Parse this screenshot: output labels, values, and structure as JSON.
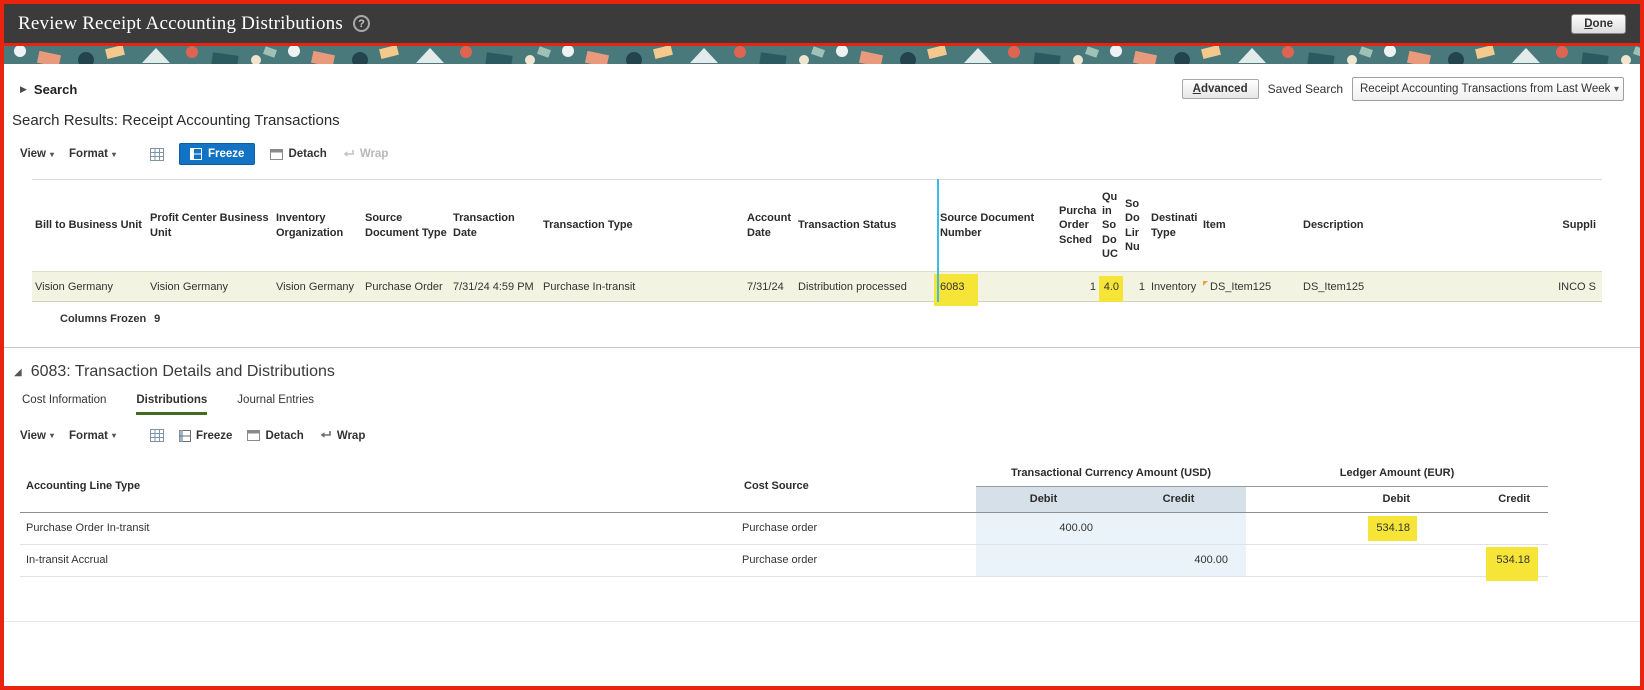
{
  "colors": {
    "annotation_red": "#e8240f",
    "topbar_bg": "#3b3b3b",
    "freeze_active_blue": "#1273c4",
    "freeze_line_blue": "#3fbbe8",
    "highlight_yellow": "#f6e437",
    "selected_row_bg": "#f3f3e2",
    "usd_header_bg": "#d5e0e9",
    "usd_cell_bg": "#ebf3fa",
    "tab_active_underline": "#3f6e21",
    "banner_teal": "#49797b"
  },
  "icons": {
    "help_glyph": "?",
    "disclosure_collapsed": "▶",
    "disclosure_expanded": "◢",
    "menu_arrow": "▾"
  },
  "topbar": {
    "title": "Review Receipt Accounting Distributions",
    "done_label": "Done"
  },
  "search": {
    "label": "Search",
    "advanced_label": "Advanced",
    "saved_search_label": "Saved Search",
    "saved_search_value": "Receipt Accounting Transactions from Last Week"
  },
  "toolbar": {
    "view": "View",
    "format": "Format",
    "freeze": "Freeze",
    "detach": "Detach",
    "wrap": "Wrap"
  },
  "results": {
    "heading": "Search Results: Receipt Accounting Transactions",
    "columns": [
      "Bill to Business Unit",
      "Profit Center Business Unit",
      "Inventory Organization",
      "Source Document Type",
      "Transaction Date",
      "Transaction Type",
      "Account Date",
      "Transaction Status",
      "Source Document Number",
      "Purcha Order Sched",
      "Qu in So Do UC",
      "So Do Lir Nu",
      "Destinati Type",
      "Item",
      "Description",
      "Suppli"
    ],
    "row": [
      "Vision Germany",
      "Vision Germany",
      "Vision Germany",
      "Purchase Order",
      "7/31/24 4:59 PM",
      "Purchase In-transit",
      "7/31/24",
      "Distribution processed",
      "6083",
      "1",
      "4.0",
      "1",
      "Inventory",
      "DS_Item125",
      "DS_Item125",
      "INCO S"
    ],
    "columns_frozen_label": "Columns Frozen",
    "columns_frozen_count": "9"
  },
  "details": {
    "heading": "6083: Transaction Details and Distributions",
    "tabs": [
      "Cost Information",
      "Distributions",
      "Journal Entries"
    ],
    "active_tab": "Distributions",
    "table": {
      "col_accounting_line_type": "Accounting Line Type",
      "col_cost_source": "Cost Source",
      "group_usd": "Transactional Currency Amount (USD)",
      "group_eur": "Ledger Amount (EUR)",
      "col_debit": "Debit",
      "col_credit": "Credit",
      "rows": [
        {
          "line_type": "Purchase Order In-transit",
          "cost_source": "Purchase order",
          "usd_debit": "400.00",
          "usd_credit": "",
          "eur_debit": "534.18",
          "eur_credit": ""
        },
        {
          "line_type": "In-transit Accrual",
          "cost_source": "Purchase order",
          "usd_debit": "",
          "usd_credit": "400.00",
          "eur_debit": "",
          "eur_credit": "534.18"
        }
      ]
    }
  }
}
